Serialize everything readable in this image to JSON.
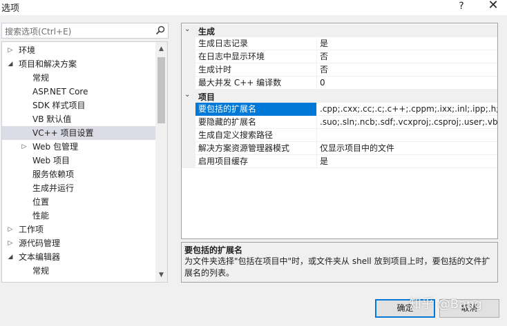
{
  "window": {
    "title": "选项",
    "help_glyph": "?",
    "close_glyph": "✕"
  },
  "search": {
    "placeholder": "搜索选项(Ctrl+E)"
  },
  "tree": [
    {
      "label": "环境",
      "level": 0,
      "arrow": "▷",
      "selected": false
    },
    {
      "label": "项目和解决方案",
      "level": 0,
      "arrow": "◢",
      "selected": false
    },
    {
      "label": "常规",
      "level": 1,
      "arrow": "",
      "selected": false
    },
    {
      "label": "ASP.NET Core",
      "level": 1,
      "arrow": "",
      "selected": false
    },
    {
      "label": "SDK 样式项目",
      "level": 1,
      "arrow": "",
      "selected": false
    },
    {
      "label": "VB 默认值",
      "level": 1,
      "arrow": "",
      "selected": false
    },
    {
      "label": "VC++ 项目设置",
      "level": 1,
      "arrow": "",
      "selected": true
    },
    {
      "label": "Web 包管理",
      "level": 1,
      "arrow": "▷",
      "selected": false
    },
    {
      "label": "Web 项目",
      "level": 1,
      "arrow": "",
      "selected": false
    },
    {
      "label": "服务依赖项",
      "level": 1,
      "arrow": "",
      "selected": false
    },
    {
      "label": "生成并运行",
      "level": 1,
      "arrow": "",
      "selected": false
    },
    {
      "label": "位置",
      "level": 1,
      "arrow": "",
      "selected": false
    },
    {
      "label": "性能",
      "level": 1,
      "arrow": "",
      "selected": false
    },
    {
      "label": "工作项",
      "level": 0,
      "arrow": "▷",
      "selected": false
    },
    {
      "label": "源代码管理",
      "level": 0,
      "arrow": "▷",
      "selected": false
    },
    {
      "label": "文本编辑器",
      "level": 0,
      "arrow": "◢",
      "selected": false
    },
    {
      "label": "常规",
      "level": 1,
      "arrow": "",
      "selected": false
    }
  ],
  "grid": {
    "categories": [
      {
        "name": "生成",
        "arrow": "⌄",
        "properties": [
          {
            "name": "生成日志记录",
            "value": "是",
            "selected": false
          },
          {
            "name": "在日志中显示环境",
            "value": "否",
            "selected": false
          },
          {
            "name": "生成计时",
            "value": "否",
            "selected": false
          },
          {
            "name": "最大并发 C++ 编译数",
            "value": "0",
            "selected": false
          }
        ]
      },
      {
        "name": "项目",
        "arrow": "⌄",
        "properties": [
          {
            "name": "要包括的扩展名",
            "value": ".cpp;.cxx;.cc;.c;.c++;.cppm;.ixx;.inl;.ipp;.h;.hxx;.",
            "selected": true
          },
          {
            "name": "要隐藏的扩展名",
            "value": ".suo;.sln;.ncb;.sdf;.vcxproj;.csproj;.user;.vbpro",
            "selected": false
          },
          {
            "name": "生成自定义搜索路径",
            "value": "",
            "selected": false
          },
          {
            "name": "解决方案资源管理器模式",
            "value": "仅显示项目中的文件",
            "selected": false
          },
          {
            "name": "启用项目缓存",
            "value": "是",
            "selected": false
          }
        ]
      }
    ]
  },
  "description": {
    "title": "要包括的扩展名",
    "text": "为文件夹选择\"包括在项目中\"时，或文件夹从 shell 放到项目上时，要包括的文件扩展名的列表。"
  },
  "buttons": {
    "ok": "确定",
    "cancel": "取消"
  },
  "watermark": "知乎 @Bang",
  "colors": {
    "selection_blue": "#0078d7",
    "tree_selected": "#dcdce6",
    "panel_bg": "#f0f0f0"
  }
}
